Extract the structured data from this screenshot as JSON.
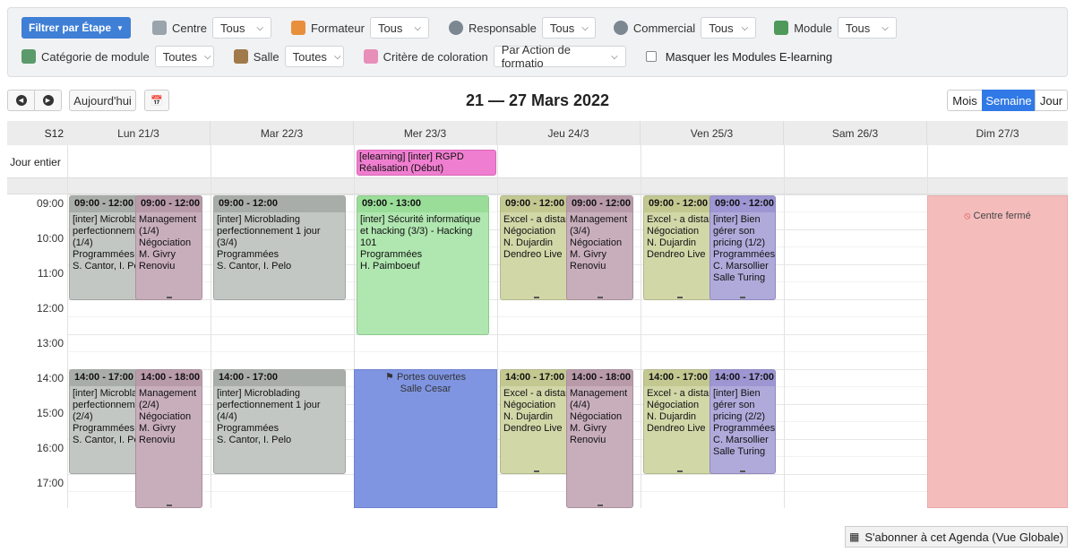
{
  "filters": {
    "filter_by_step": "Filtrer par Étape",
    "row1": [
      {
        "label": "Centre",
        "value": "Tous",
        "icon": "building-icon"
      },
      {
        "label": "Formateur",
        "value": "Tous",
        "icon": "trainer-icon"
      },
      {
        "label": "Responsable",
        "value": "Tous",
        "icon": "manager-icon"
      },
      {
        "label": "Commercial",
        "value": "Tous",
        "icon": "sales-icon"
      },
      {
        "label": "Module",
        "value": "Tous",
        "icon": "puzzle-icon"
      }
    ],
    "row2": [
      {
        "label": "Catégorie de module",
        "value": "Toutes",
        "icon": "category-icon"
      },
      {
        "label": "Salle",
        "value": "Toutes",
        "icon": "room-icon"
      },
      {
        "label": "Critère de coloration",
        "value": "Par Action de formatio",
        "icon": "paint-roller-icon"
      }
    ],
    "hide_elearning": "Masquer les Modules E-learning"
  },
  "toolbar": {
    "today": "Aujourd'hui",
    "title": "21 — 27 Mars 2022",
    "views": [
      "Mois",
      "Semaine",
      "Jour"
    ],
    "active_view": "Semaine"
  },
  "calendar": {
    "week_label": "S12",
    "allday_label": "Jour entier",
    "days": [
      "Lun 21/3",
      "Mar 22/3",
      "Mer 23/3",
      "Jeu 24/3",
      "Ven 25/3",
      "Sam 26/3",
      "Dim 27/3"
    ],
    "hours": [
      "09:00",
      "10:00",
      "11:00",
      "12:00",
      "13:00",
      "14:00",
      "15:00",
      "16:00",
      "17:00"
    ],
    "allday_event": "[elearning] [inter] RGPD\nRéalisation (Début)",
    "open_house": "Portes ouvertes\nSalle Cesar",
    "closed": "Centre fermé",
    "events": [
      {
        "id": "mon-am-a",
        "time": "09:00 - 12:00",
        "body": "[inter] Microblading\nperfectionnement\n(1/4)\nProgrammées\nS. Cantor, I. Pelo"
      },
      {
        "id": "mon-am-b",
        "time": "09:00 - 12:00",
        "body": "Management\n(1/4)\nNégociation\nM. Givry\nRenoviu"
      },
      {
        "id": "tue-am",
        "time": "09:00 - 12:00",
        "body": "[inter] Microblading\nperfectionnement 1 jour\n(3/4)\nProgrammées\nS. Cantor, I. Pelo"
      },
      {
        "id": "wed-am",
        "time": "09:00 - 13:00",
        "body": "[inter] Sécurité informatique\net hacking (3/3) - Hacking\n101\nProgrammées\nH. Paimboeuf"
      },
      {
        "id": "thu-am-a",
        "time": "09:00 - 12:00",
        "body": "Excel - a distance\nNégociation\nN. Dujardin\nDendreo Live"
      },
      {
        "id": "thu-am-b",
        "time": "09:00 - 12:00",
        "body": "Management\n(3/4)\nNégociation\nM. Givry\nRenoviu"
      },
      {
        "id": "fri-am-a",
        "time": "09:00 - 12:00",
        "body": "Excel - a distance\nNégociation\nN. Dujardin\nDendreo Live"
      },
      {
        "id": "fri-am-b",
        "time": "09:00 - 12:00",
        "body": "[inter] Bien\ngérer son\npricing (1/2)\nProgrammées\nC. Marsollier\nSalle Turing"
      },
      {
        "id": "mon-pm-a",
        "time": "14:00 - 17:00",
        "body": "[inter] Microblading\nperfectionnement\n(2/4)\nProgrammées\nS. Cantor, I. Pelo"
      },
      {
        "id": "mon-pm-b",
        "time": "14:00 - 18:00",
        "body": "Management\n(2/4)\nNégociation\nM. Givry\nRenoviu"
      },
      {
        "id": "tue-pm",
        "time": "14:00 - 17:00",
        "body": "[inter] Microblading\nperfectionnement 1 jour\n(4/4)\nProgrammées\nS. Cantor, I. Pelo"
      },
      {
        "id": "thu-pm-a",
        "time": "14:00 - 17:00",
        "body": "Excel - a distance\nNégociation\nN. Dujardin\nDendreo Live"
      },
      {
        "id": "thu-pm-b",
        "time": "14:00 - 18:00",
        "body": "Management\n(4/4)\nNégociation\nM. Givry\nRenoviu"
      },
      {
        "id": "fri-pm-a",
        "time": "14:00 - 17:00",
        "body": "Excel - a distance\nNégociation\nN. Dujardin\nDendreo Live"
      },
      {
        "id": "fri-pm-b",
        "time": "14:00 - 17:00",
        "body": "[inter] Bien\ngérer son\npricing (2/2)\nProgrammées\nC. Marsollier\nSalle Turing"
      }
    ]
  },
  "subscribe": "S'abonner à cet Agenda (Vue Globale)",
  "colors": {
    "primary": "#3f7fd6",
    "active_view": "#3079e6",
    "closed": "#f5bcbc",
    "open_house": "#7f95e2",
    "elearning": "#f07ed0"
  }
}
